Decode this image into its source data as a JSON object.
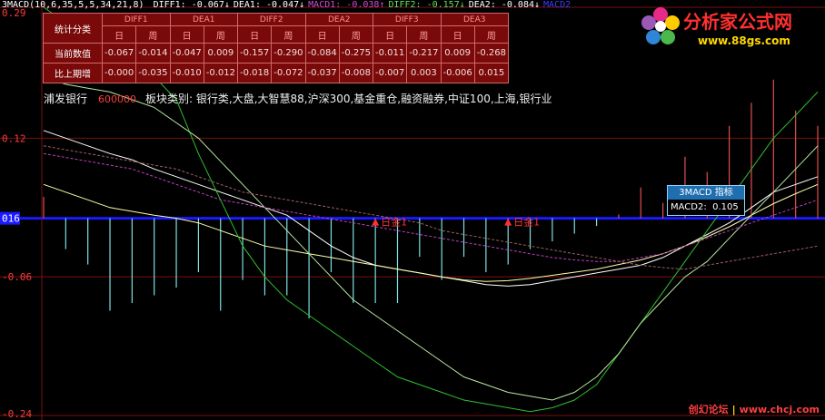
{
  "header": {
    "indicator": "3MACD(10,6,35,5,5,34,21,8)",
    "items": [
      {
        "label": "DIFF1:",
        "value": "-0.067",
        "arrow": "↓",
        "color": "#ffffff"
      },
      {
        "label": "DEA1:",
        "value": "-0.047",
        "arrow": "↓",
        "color": "#ffffff"
      },
      {
        "label": "MACD1:",
        "value": "-0.038",
        "arrow": "↑",
        "color": "#d24cd2"
      },
      {
        "label": "DIFF2:",
        "value": "-0.157",
        "arrow": "↓",
        "color": "#5ee35e"
      },
      {
        "label": "DEA2:",
        "value": "-0.084",
        "arrow": "↓",
        "color": "#ffffff"
      },
      {
        "label": "MACD2",
        "value": "",
        "arrow": "",
        "color": "#3b3bff"
      }
    ]
  },
  "stats_table": {
    "corner": "统计分类",
    "groups": [
      "DIFF1",
      "DEA1",
      "DIFF2",
      "DEA2",
      "DIFF3",
      "DEA3"
    ],
    "subheaders": [
      "日",
      "周"
    ],
    "rows": [
      {
        "label": "当前数值",
        "values": [
          "-0.067",
          "-0.014",
          "-0.047",
          "0.009",
          "-0.157",
          "-0.290",
          "-0.084",
          "-0.275",
          "-0.011",
          "-0.217",
          "0.009",
          "-0.268"
        ]
      },
      {
        "label": "比上期增",
        "values": [
          "-0.000",
          "-0.035",
          "-0.010",
          "-0.012",
          "-0.018",
          "-0.072",
          "-0.037",
          "-0.008",
          "-0.007",
          "0.003",
          "-0.006",
          "0.015"
        ]
      }
    ]
  },
  "ticker": {
    "name": "浦发银行",
    "code": "600000",
    "sectors": "板块类别: 银行类,大盘,大智慧88,沪深300,基金重仓,融资融券,中证100,上海,银行业"
  },
  "logo": {
    "brand": "分析家公式网",
    "url": "www.88gs.com"
  },
  "tooltip": {
    "title": "3MACD 指标",
    "label": "MACD2:",
    "value": "0.105"
  },
  "footer": {
    "left": "创幻论坛",
    "right": "www.chcj.com"
  },
  "markers": [
    "日金1",
    "日金1"
  ],
  "colors": {
    "diff1": "#ffffff",
    "dea1": "#ffffaa",
    "diff2": "#2fbf2f",
    "dea2": "#b8e8a0",
    "ma_pink": "#c040c0",
    "ma_dark": "#a06060",
    "zero": "#1a1aff",
    "pos_bar": "#e05050",
    "neg_bar": "#7fdfe0",
    "grid": "#7a1010",
    "axis_text": "#ff3b3b"
  },
  "chart_data": {
    "type": "line",
    "yticks": [
      {
        "label": "0.29",
        "value": 0.29
      },
      {
        "label": "0.12",
        "value": 0.12
      },
      {
        "label": "016",
        "value": 0.016
      },
      {
        "label": "-0.06",
        "value": -0.06
      },
      {
        "label": "-0.24",
        "value": -0.24
      }
    ],
    "ylim": [
      -0.24,
      0.29
    ],
    "n": 36,
    "series": [
      {
        "name": "DIFF1",
        "values": [
          0.13,
          0.12,
          0.11,
          0.1,
          0.092,
          0.08,
          0.07,
          0.06,
          0.05,
          0.04,
          0.03,
          0.02,
          0.0,
          -0.02,
          -0.035,
          -0.045,
          -0.05,
          -0.055,
          -0.06,
          -0.065,
          -0.07,
          -0.072,
          -0.07,
          -0.065,
          -0.06,
          -0.055,
          -0.05,
          -0.045,
          -0.035,
          -0.02,
          -0.005,
          0.01,
          0.03,
          0.05,
          0.06,
          0.07
        ],
        "color": "#ffffff"
      },
      {
        "name": "DEA1",
        "values": [
          0.06,
          0.05,
          0.04,
          0.03,
          0.025,
          0.02,
          0.016,
          0.01,
          0.0,
          -0.01,
          -0.02,
          -0.025,
          -0.03,
          -0.035,
          -0.04,
          -0.045,
          -0.05,
          -0.055,
          -0.06,
          -0.064,
          -0.066,
          -0.065,
          -0.062,
          -0.058,
          -0.054,
          -0.05,
          -0.044,
          -0.038,
          -0.03,
          -0.02,
          -0.008,
          0.005,
          0.02,
          0.035,
          0.048,
          0.06
        ],
        "color": "#ffffaa"
      },
      {
        "name": "DIFF2",
        "values": [
          0.29,
          0.27,
          0.25,
          0.22,
          0.2,
          0.2,
          0.17,
          0.1,
          0.04,
          -0.02,
          -0.06,
          -0.09,
          -0.11,
          -0.13,
          -0.15,
          -0.17,
          -0.19,
          -0.2,
          -0.21,
          -0.22,
          -0.225,
          -0.23,
          -0.235,
          -0.23,
          -0.22,
          -0.2,
          -0.16,
          -0.12,
          -0.08,
          -0.04,
          0.0,
          0.04,
          0.08,
          0.12,
          0.15,
          0.18
        ],
        "color": "#2fbf2f"
      },
      {
        "name": "DEA2",
        "values": [
          0.2,
          0.19,
          0.185,
          0.18,
          0.17,
          0.16,
          0.14,
          0.12,
          0.09,
          0.06,
          0.03,
          0.0,
          -0.03,
          -0.06,
          -0.09,
          -0.11,
          -0.13,
          -0.15,
          -0.17,
          -0.19,
          -0.2,
          -0.21,
          -0.215,
          -0.22,
          -0.21,
          -0.19,
          -0.16,
          -0.12,
          -0.09,
          -0.06,
          -0.04,
          -0.01,
          0.02,
          0.05,
          0.08,
          0.11
        ],
        "color": "#b8e8a0"
      },
      {
        "name": "MA_PINK",
        "values": [
          0.1,
          0.095,
          0.09,
          0.085,
          0.08,
          0.07,
          0.06,
          0.05,
          0.04,
          0.035,
          0.03,
          0.025,
          0.02,
          0.015,
          0.01,
          0.005,
          0.0,
          -0.005,
          -0.01,
          -0.015,
          -0.02,
          -0.025,
          -0.03,
          -0.035,
          -0.038,
          -0.04,
          -0.04,
          -0.035,
          -0.03,
          -0.02,
          -0.01,
          0.0,
          0.01,
          0.02,
          0.03,
          0.04
        ],
        "color": "#c040c0"
      },
      {
        "name": "MA_DARK",
        "values": [
          0.11,
          0.105,
          0.1,
          0.095,
          0.09,
          0.085,
          0.08,
          0.07,
          0.06,
          0.05,
          0.045,
          0.04,
          0.035,
          0.03,
          0.025,
          0.02,
          0.015,
          0.01,
          0.0,
          -0.005,
          -0.01,
          -0.015,
          -0.02,
          -0.025,
          -0.03,
          -0.035,
          -0.04,
          -0.045,
          -0.048,
          -0.05,
          -0.045,
          -0.04,
          -0.035,
          -0.03,
          -0.025,
          -0.02
        ],
        "color": "#a06060"
      }
    ],
    "bars": [
      0.028,
      -0.04,
      -0.06,
      -0.12,
      -0.11,
      -0.1,
      -0.09,
      -0.07,
      -0.12,
      -0.08,
      -0.1,
      -0.1,
      -0.13,
      -0.07,
      -0.11,
      -0.11,
      -0.11,
      -0.05,
      -0.08,
      -0.05,
      -0.07,
      -0.06,
      -0.04,
      -0.03,
      -0.02,
      -0.01,
      0.005,
      0.04,
      0.02,
      0.08,
      0.06,
      0.12,
      0.15,
      0.18,
      0.14,
      0.12
    ]
  }
}
